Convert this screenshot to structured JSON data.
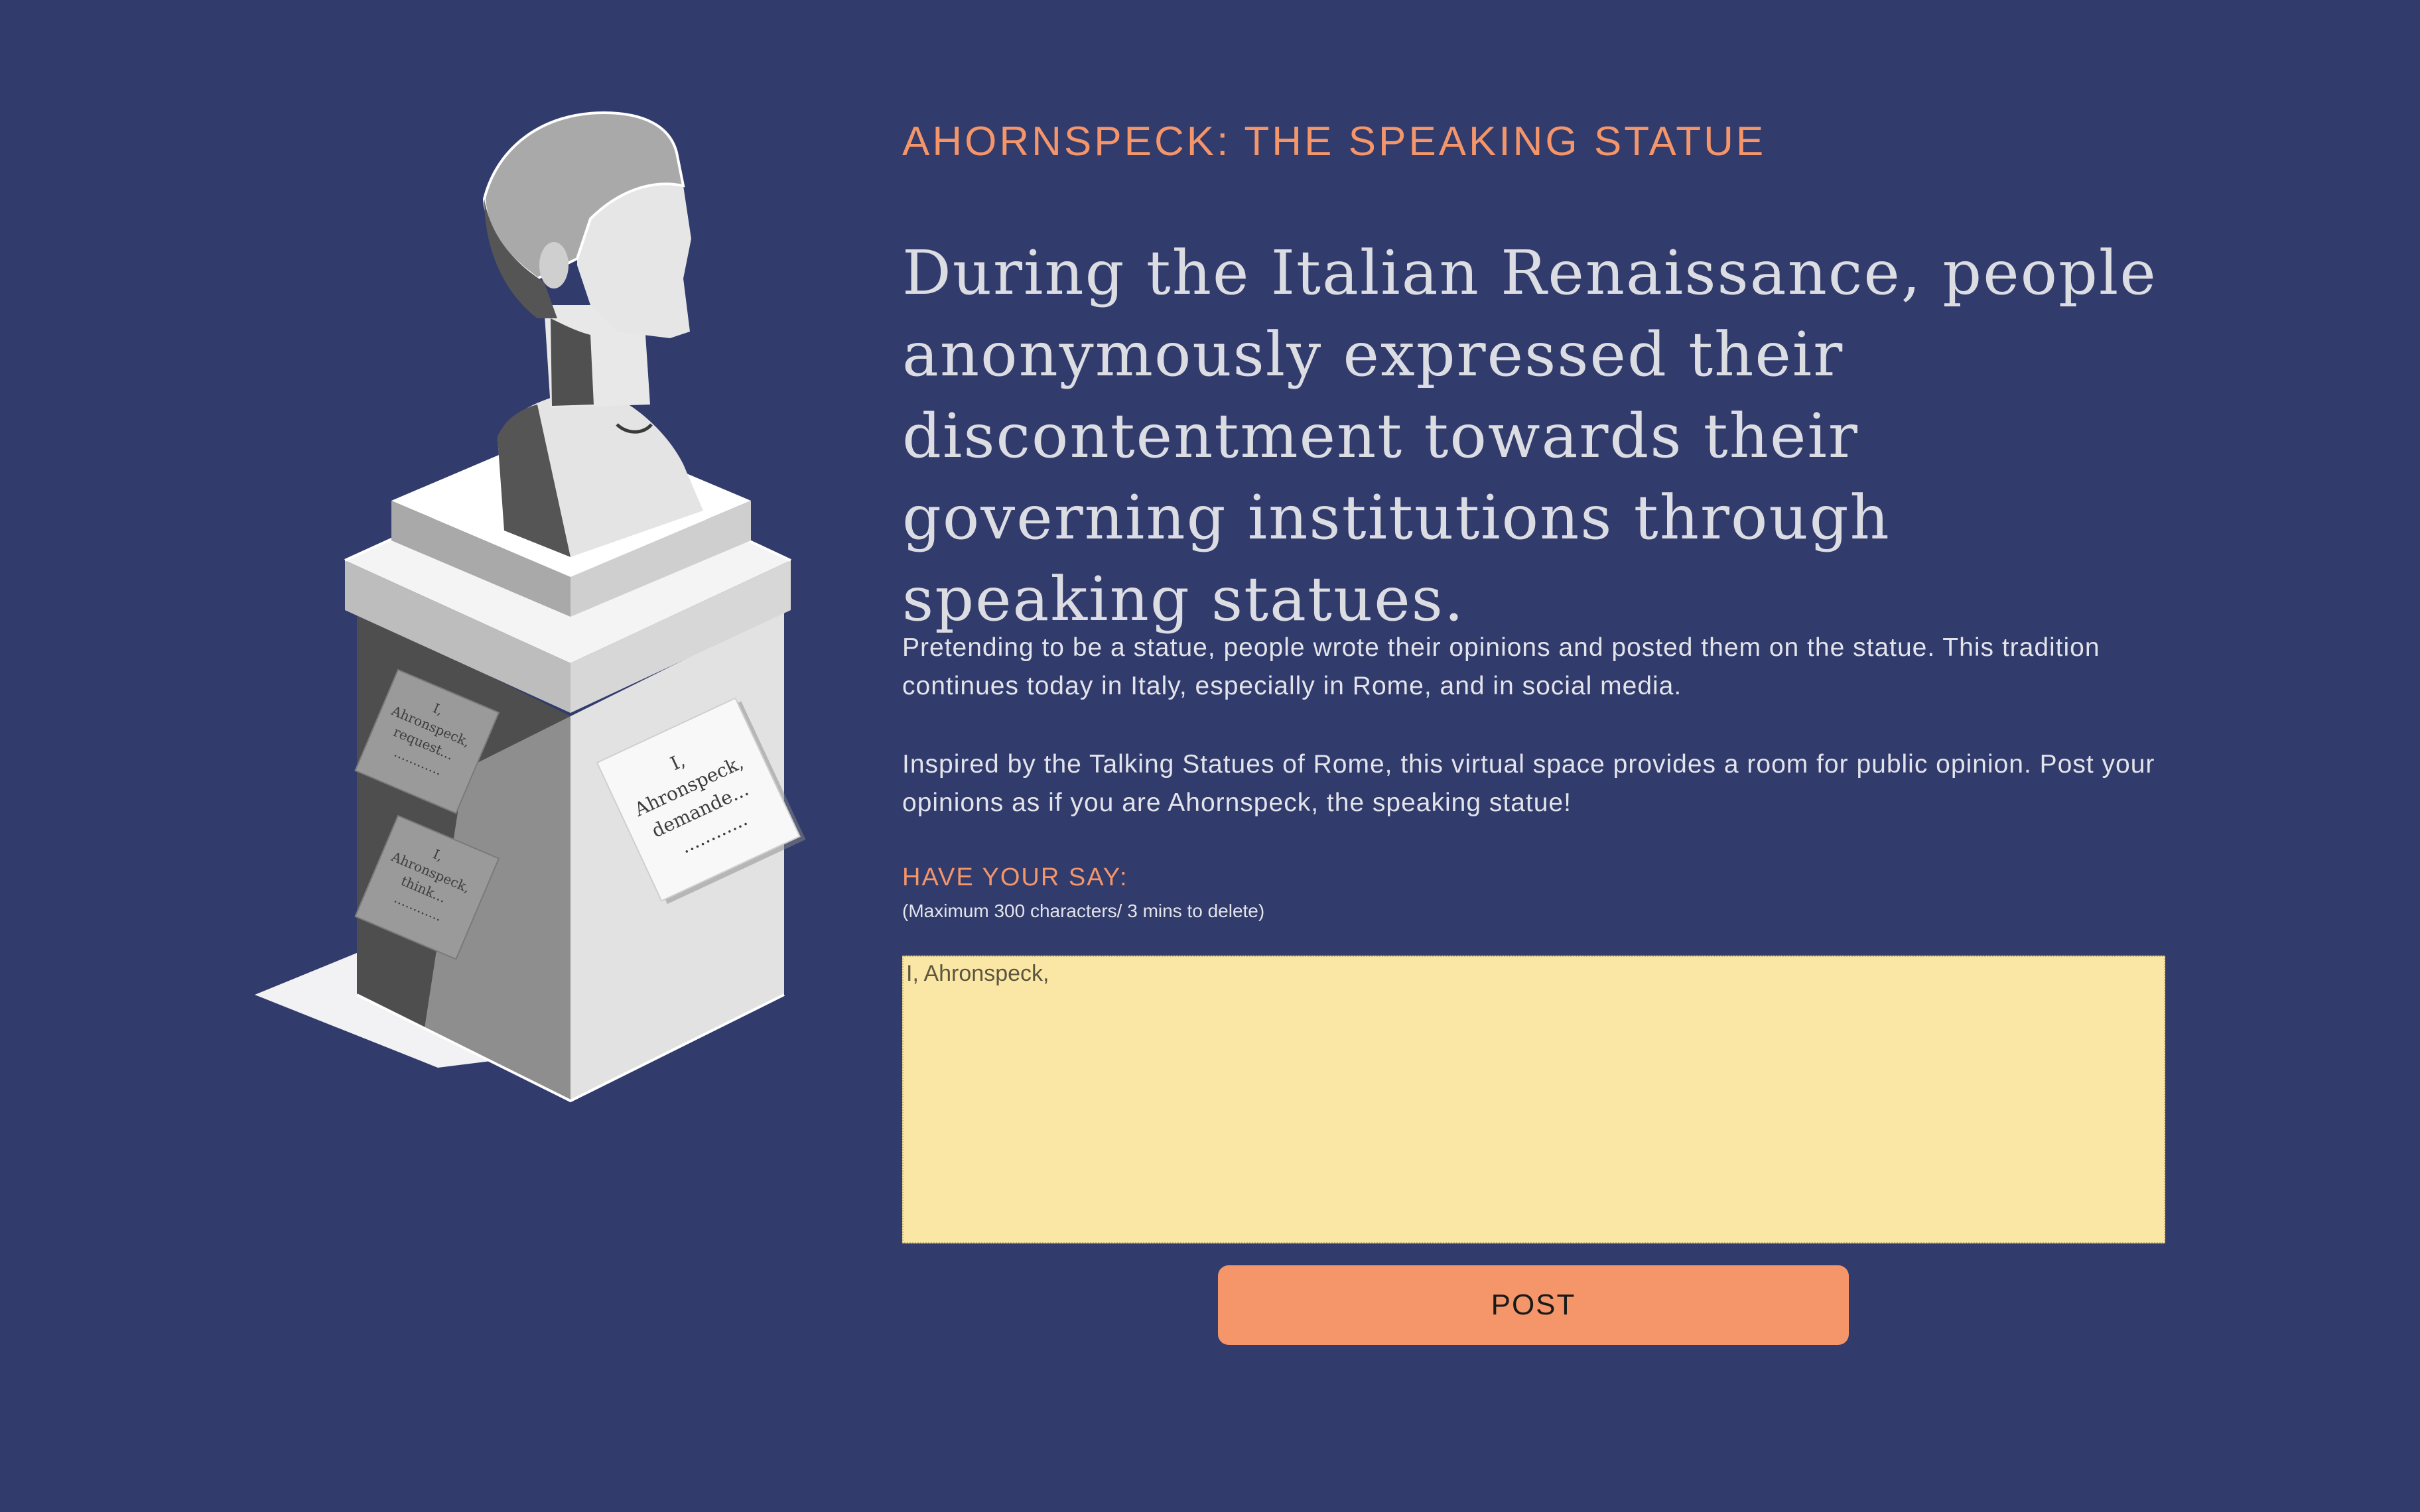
{
  "page": {
    "title": "AHORNSPECK: THE SPEAKING STATUE",
    "headline": "During the Italian Renaissance, people anonymously expressed their discontentment towards their governing institutions through speaking statues.",
    "paragraphs": [
      "Pretending to be a statue, people wrote their opinions and posted them on the statue. This tradition continues today in Italy, especially in Rome, and in social media.",
      "Inspired by the Talking Statues of Rome, this virtual space provides a room for public opinion. Post your opinions as if you are Ahornspeck, the speaking statue!"
    ]
  },
  "statue": {
    "notes": [
      {
        "lines": [
          "I,",
          "Ahronspeck,",
          "request...",
          "............"
        ]
      },
      {
        "lines": [
          "I,",
          "Ahronspeck,",
          "think...",
          "............"
        ]
      },
      {
        "lines": [
          "I,",
          "Ahronspeck,",
          "demande...",
          "............"
        ]
      }
    ]
  },
  "form": {
    "label": "HAVE YOUR SAY:",
    "note": "(Maximum 300 characters/ 3 mins to delete)",
    "input_value": "I, Ahronspeck,",
    "post_label": "POST"
  },
  "colors": {
    "background": "#313b6c",
    "accent": "#f4956a",
    "input_background": "#fae7a5",
    "text": "#e3e4ea"
  }
}
